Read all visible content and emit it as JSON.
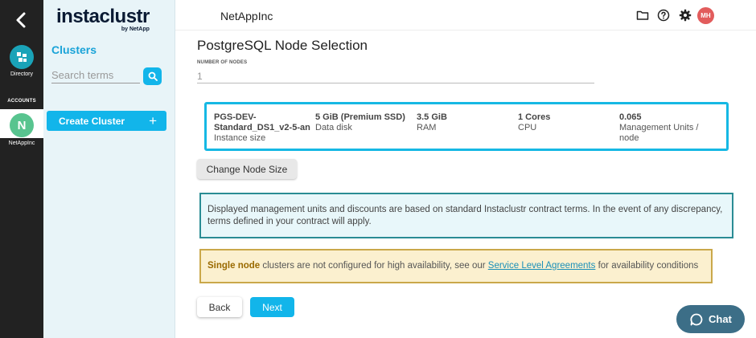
{
  "rail": {
    "directory_label": "Directory",
    "accounts_label": "ACCOUNTS",
    "account_initial": "N",
    "account_name": "NetAppInc"
  },
  "sidebar": {
    "logo_text": "instaclustr",
    "logo_sub": "by NetApp",
    "title": "Clusters",
    "search_placeholder": "Search terms",
    "create_label": "Create Cluster",
    "create_plus": "+"
  },
  "header": {
    "org_name": "NetAppInc",
    "user_initials": "MH",
    "icons": [
      "folder-icon",
      "help-icon",
      "gear-icon"
    ]
  },
  "main": {
    "title": "PostgreSQL Node Selection",
    "nodes_label": "NUMBER OF NODES",
    "nodes_value": "1",
    "instance": {
      "size_value": "PGS-DEV-Standard_DS1_v2-5-an",
      "size_label": "Instance size",
      "disk_value": "5 GiB (Premium SSD)",
      "disk_label": "Data disk",
      "ram_value": "3.5 GiB",
      "ram_label": "RAM",
      "cpu_value": "1 Cores",
      "cpu_label": "CPU",
      "mu_value": "0.065",
      "mu_label": "Management Units / node"
    },
    "change_size_label": "Change Node Size",
    "info_text": "Displayed management units and discounts are based on standard Instaclustr contract terms. In the event of any discrepancy, terms defined in your contract will apply.",
    "warning": {
      "strong": "Single node",
      "text1": " clusters are not configured for high availability, see our ",
      "link": "Service Level Agreements",
      "text2": " for availability conditions"
    },
    "back_label": "Back",
    "next_label": "Next"
  },
  "chat": {
    "label": "Chat"
  },
  "colors": {
    "accent": "#12b5ea",
    "rail_bg": "#222222",
    "sidebar_bg": "#e8f4f8",
    "info_border": "#2a8c94",
    "warn_border": "#caa84a",
    "chat_bg": "#3c6e87"
  }
}
